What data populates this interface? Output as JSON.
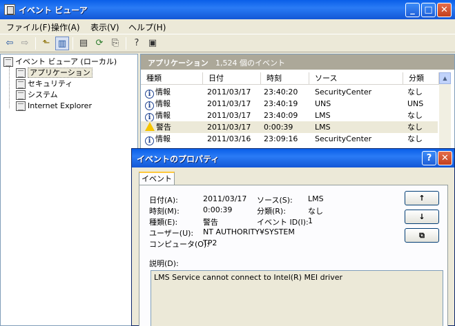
{
  "window": {
    "title": "イベント ビューア",
    "min_label": "_",
    "max_label": "□",
    "close_label": "✕"
  },
  "menu": [
    "ファイル(F)",
    "操作(A)",
    "表示(V)",
    "ヘルプ(H)"
  ],
  "toolbar": {
    "icons": [
      "back-arrow-icon",
      "forward-arrow-icon",
      "up-folder-icon",
      "show-hide-tree-icon",
      "properties-icon",
      "refresh-icon",
      "export-list-icon",
      "help-icon",
      "console-icon"
    ]
  },
  "tree": {
    "root": "イベント ビューア (ローカル)",
    "items": [
      "アプリケーション",
      "セキュリティ",
      "システム",
      "Internet Explorer"
    ]
  },
  "list": {
    "header_title": "アプリケーション",
    "header_count": "1,524 個のイベント",
    "columns": [
      "種類",
      "日付",
      "時刻",
      "ソース",
      "分類"
    ],
    "rows": [
      {
        "type": "情報",
        "icon": "info-icon",
        "date": "2011/03/17",
        "time": "23:40:20",
        "source": "SecurityCenter",
        "category": "なし"
      },
      {
        "type": "情報",
        "icon": "info-icon",
        "date": "2011/03/17",
        "time": "23:40:19",
        "source": "UNS",
        "category": "UNS"
      },
      {
        "type": "情報",
        "icon": "info-icon",
        "date": "2011/03/17",
        "time": "23:40:09",
        "source": "LMS",
        "category": "なし"
      },
      {
        "type": "警告",
        "icon": "warning-icon",
        "date": "2011/03/17",
        "time": "0:00:39",
        "source": "LMS",
        "category": "なし"
      },
      {
        "type": "情報",
        "icon": "info-icon",
        "date": "2011/03/16",
        "time": "23:09:16",
        "source": "SecurityCenter",
        "category": "なし"
      }
    ]
  },
  "dialog": {
    "title": "イベントのプロパティ",
    "help_label": "?",
    "close_label": "✕",
    "tab": "イベント",
    "fields": {
      "date_label": "日付(A):",
      "date_value": "2011/03/17",
      "source_label": "ソース(S):",
      "source_value": "LMS",
      "time_label": "時刻(M):",
      "time_value": "0:00:39",
      "category_label": "分類(R):",
      "category_value": "なし",
      "type_label": "種類(E):",
      "type_value": "警告",
      "event_id_label": "イベント ID(I):",
      "event_id_value": "1",
      "user_label": "ユーザー(U):",
      "user_value": "NT AUTHORITY¥SYSTEM",
      "computer_label": "コンピュータ(O):",
      "computer_value": "TP2"
    },
    "description_label": "説明(D):",
    "description": "LMS Service cannot connect to Intel(R) MEI driver",
    "up_label": "↑",
    "down_label": "↓",
    "copy_label": "⧉"
  }
}
